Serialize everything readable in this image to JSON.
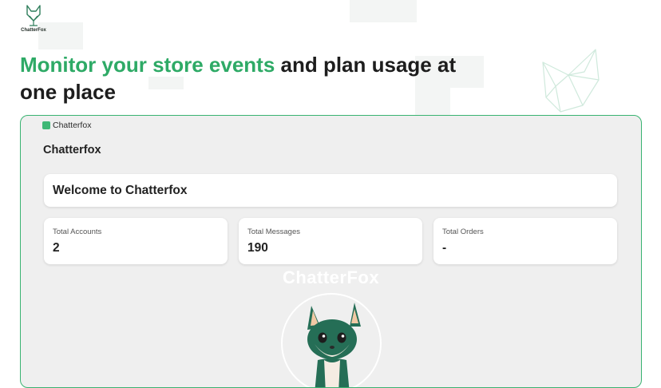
{
  "brand": {
    "logo_text": "ChatterFox"
  },
  "hero": {
    "accent": "Monitor your store events",
    "rest_line1": " and plan usage at",
    "rest_line2": "one place"
  },
  "app": {
    "tab_label": "Chatterfox",
    "panel_title": "Chatterfox",
    "welcome": "Welcome to Chatterfox",
    "stats": [
      {
        "label": "Total Accounts",
        "value": "2"
      },
      {
        "label": "Total Messages",
        "value": "190"
      },
      {
        "label": "Total Orders",
        "value": "-"
      }
    ],
    "watermark": "ChatterFox"
  },
  "icons": {
    "logo": "fox-logo-icon",
    "tab": "app-square-icon",
    "decoration": "origami-fox-outline-icon",
    "mascot": "fox-mascot-icon"
  },
  "colors": {
    "accent": "#2eaa66",
    "frame_border": "#39b371",
    "panel_bg": "#efefef",
    "fox_green": "#256e56"
  }
}
